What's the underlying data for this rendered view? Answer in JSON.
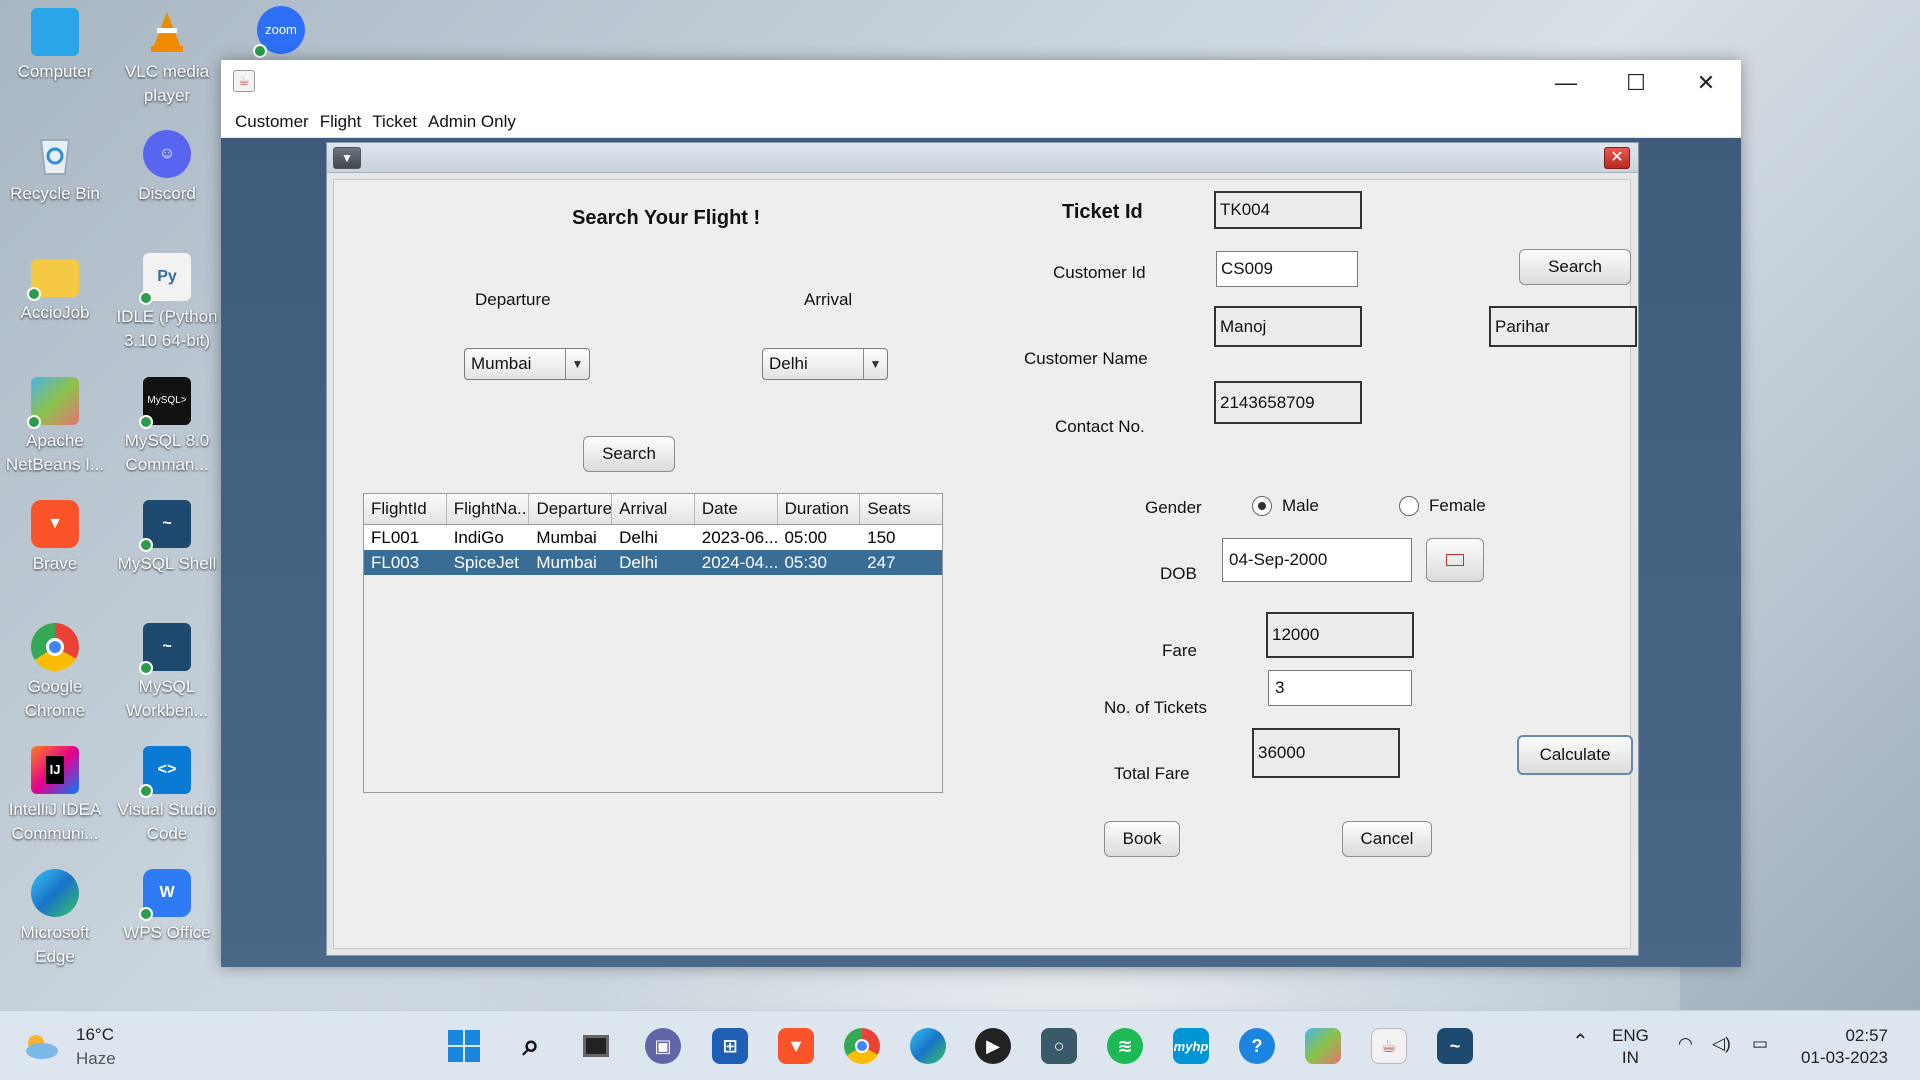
{
  "desktop": {
    "icons": [
      {
        "label": "Computer",
        "icon": "monitor-icon"
      },
      {
        "label": "VLC media player",
        "icon": "vlc-cone-icon"
      },
      {
        "label": "Recycle Bin",
        "icon": "recycle-bin-icon"
      },
      {
        "label": "Discord",
        "icon": "discord-icon"
      },
      {
        "label": "AccioJob",
        "icon": "folder-icon"
      },
      {
        "label": "IDLE (Python 3.10 64-bit)",
        "icon": "python-idle-icon"
      },
      {
        "label": "Apache NetBeans I...",
        "icon": "netbeans-icon"
      },
      {
        "label": "MySQL 8.0 Comman...",
        "icon": "mysql-console-icon"
      },
      {
        "label": "Brave",
        "icon": "brave-icon"
      },
      {
        "label": "MySQL Shell",
        "icon": "mysql-shell-icon"
      },
      {
        "label": "Google Chrome",
        "icon": "chrome-icon"
      },
      {
        "label": "MySQL Workben...",
        "icon": "mysql-workbench-icon"
      },
      {
        "label": "IntelliJ IDEA Communi...",
        "icon": "intellij-icon"
      },
      {
        "label": "Visual Studio Code",
        "icon": "vscode-icon"
      },
      {
        "label": "Microsoft Edge",
        "icon": "edge-icon"
      },
      {
        "label": "WPS Office",
        "icon": "wps-office-icon"
      }
    ],
    "zoom_label": "zoom"
  },
  "window": {
    "menu": [
      "Customer",
      "Flight",
      "Ticket",
      "Admin Only"
    ],
    "minimize": "—",
    "maximize": "☐",
    "close": "✕"
  },
  "form": {
    "search_heading": "Search Your Flight !",
    "departure_label": "Departure",
    "arrival_label": "Arrival",
    "departure_value": "Mumbai",
    "arrival_value": "Delhi",
    "flight_search_button": "Search",
    "ticket_id_label": "Ticket Id",
    "ticket_id_value": "TK004",
    "customer_id_label": "Customer Id",
    "customer_id_value": "CS009",
    "customer_search_button": "Search",
    "customer_name_label": "Customer Name",
    "first_name_value": "Manoj",
    "last_name_value": "Parihar",
    "contact_label": "Contact No.",
    "contact_value": "2143658709",
    "gender_label": "Gender",
    "gender_male": "Male",
    "gender_female": "Female",
    "gender_selected": "Male",
    "dob_label": "DOB",
    "dob_value": "04-Sep-2000",
    "fare_label": "Fare",
    "fare_value": "12000",
    "tickets_label": "No. of Tickets",
    "tickets_value": "3",
    "total_fare_label": "Total Fare",
    "total_fare_value": "36000",
    "calculate_button": "Calculate",
    "book_button": "Book",
    "cancel_button": "Cancel"
  },
  "flight_table": {
    "columns": [
      "FlightId",
      "FlightNa...",
      "Departure",
      "Arrival",
      "Date",
      "Duration",
      "Seats"
    ],
    "rows": [
      [
        "FL001",
        "IndiGo",
        "Mumbai",
        "Delhi",
        "2023-06...",
        "05:00",
        "150"
      ],
      [
        "FL003",
        "SpiceJet",
        "Mumbai",
        "Delhi",
        "2024-04...",
        "05:30",
        "247"
      ]
    ],
    "selected_row": 1
  },
  "taskbar": {
    "temperature": "16°C",
    "weather": "Haze",
    "lang_top": "ENG",
    "lang_bottom": "IN",
    "time": "02:57",
    "date": "01-03-2023"
  }
}
